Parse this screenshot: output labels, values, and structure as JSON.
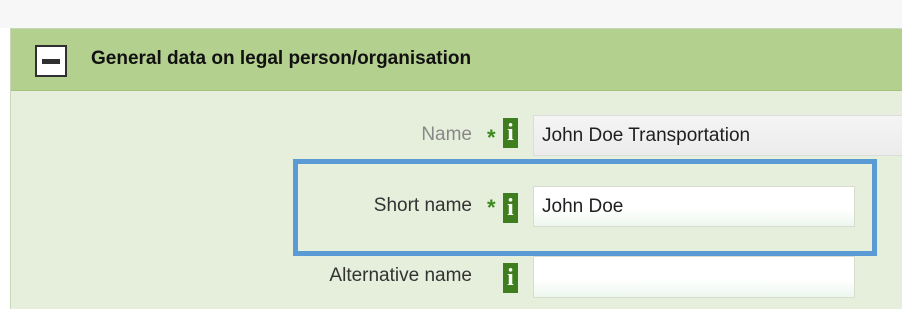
{
  "panel": {
    "title": "General data on legal person/organisation",
    "collapse_icon": "minus-square-icon"
  },
  "fields": {
    "name": {
      "label": "Name",
      "required_marker": "*",
      "info_icon": "i",
      "value": "John Doe Transportation"
    },
    "short_name": {
      "label": "Short name",
      "required_marker": "*",
      "info_icon": "i",
      "value": "John Doe"
    },
    "alternative_name": {
      "label": "Alternative name",
      "info_icon": "i",
      "value": ""
    }
  },
  "colors": {
    "header_bg": "#b3d08e",
    "panel_bg": "#e6efdc",
    "info_icon_bg": "#3f7e1e",
    "required_star": "#3c8a1e",
    "highlight_border": "#5b9bd5"
  }
}
